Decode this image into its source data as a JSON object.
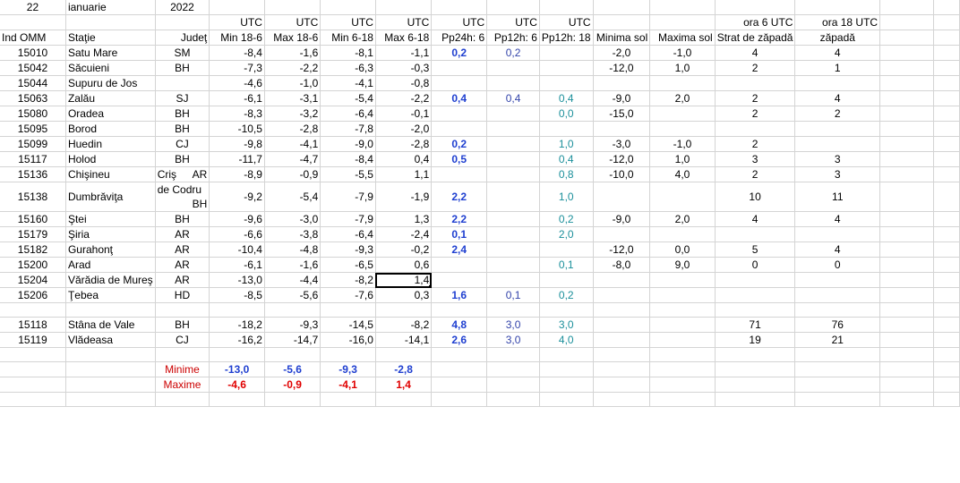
{
  "top": {
    "day": "22",
    "month": "ianuarie",
    "year": "2022"
  },
  "utc_row": [
    "UTC",
    "UTC",
    "UTC",
    "UTC",
    "UTC",
    "UTC",
    "UTC"
  ],
  "utc_row_extra": [
    "ora 6 UTC",
    "ora 18 UTC"
  ],
  "headers": [
    "Ind OMM",
    "Staţie",
    "Judeţ",
    "Min 18-6",
    "Max 18-6",
    "Min 6-18",
    "Max 6-18",
    "Pp24h: 6",
    "Pp12h: 6",
    "Pp12h: 18",
    "Minima sol",
    "Maxima sol",
    "Strat de zăpadă",
    "zăpadă"
  ],
  "rows": [
    {
      "id": "15010",
      "st1": "Satu Mare",
      "st2": "",
      "jud": "SM",
      "min186": "-8,4",
      "max186": "-1,6",
      "min618": "-8,1",
      "max618": "-1,1",
      "pp24": "0,2",
      "pp12a": "0,2",
      "pp12b": "",
      "minsol": "-2,0",
      "maxsol": "-1,0",
      "snow6": "4",
      "snow18": "4"
    },
    {
      "id": "15042",
      "st1": "Săcuieni",
      "st2": "",
      "jud": "BH",
      "min186": "-7,3",
      "max186": "-2,2",
      "min618": "-6,3",
      "max618": "-0,3",
      "pp24": "",
      "pp12a": "",
      "pp12b": "",
      "minsol": "-12,0",
      "maxsol": "1,0",
      "snow6": "2",
      "snow18": "1"
    },
    {
      "id": "15044",
      "st1": "Supuru de Jos",
      "st2": "",
      "jud": "",
      "min186": "-4,6",
      "max186": "-1,0",
      "min618": "-4,1",
      "max618": "-0,8",
      "pp24": "",
      "pp12a": "",
      "pp12b": "",
      "minsol": "",
      "maxsol": "",
      "snow6": "",
      "snow18": ""
    },
    {
      "id": "15063",
      "st1": "Zalău",
      "st2": "",
      "jud": "SJ",
      "min186": "-6,1",
      "max186": "-3,1",
      "min618": "-5,4",
      "max618": "-2,2",
      "pp24": "0,4",
      "pp12a": "0,4",
      "pp12b": "0,4",
      "minsol": "-9,0",
      "maxsol": "2,0",
      "snow6": "2",
      "snow18": "4"
    },
    {
      "id": "15080",
      "st1": "Oradea",
      "st2": "",
      "jud": "BH",
      "min186": "-8,3",
      "max186": "-3,2",
      "min618": "-6,4",
      "max618": "-0,1",
      "pp24": "",
      "pp12a": "",
      "pp12b": "0,0",
      "minsol": "-15,0",
      "maxsol": "",
      "snow6": "2",
      "snow18": "2"
    },
    {
      "id": "15095",
      "st1": "Borod",
      "st2": "",
      "jud": "BH",
      "min186": "-10,5",
      "max186": "-2,8",
      "min618": "-7,8",
      "max618": "-2,0",
      "pp24": "",
      "pp12a": "",
      "pp12b": "",
      "minsol": "",
      "maxsol": "",
      "snow6": "",
      "snow18": ""
    },
    {
      "id": "15099",
      "st1": "Huedin",
      "st2": "",
      "jud": "CJ",
      "min186": "-9,8",
      "max186": "-4,1",
      "min618": "-9,0",
      "max618": "-2,8",
      "pp24": "0,2",
      "pp12a": "",
      "pp12b": "1,0",
      "minsol": "-3,0",
      "maxsol": "-1,0",
      "snow6": "2",
      "snow18": ""
    },
    {
      "id": "15117",
      "st1": "Holod",
      "st2": "",
      "jud": "BH",
      "min186": "-11,7",
      "max186": "-4,7",
      "min618": "-8,4",
      "max618": "0,4",
      "pp24": "0,5",
      "pp12a": "",
      "pp12b": "0,4",
      "minsol": "-12,0",
      "maxsol": "1,0",
      "snow6": "3",
      "snow18": "3"
    },
    {
      "id": "15136",
      "st1": "Chişineu",
      "st2": "Criş",
      "jud": "AR",
      "min186": "-8,9",
      "max186": "-0,9",
      "min618": "-5,5",
      "max618": "1,1",
      "pp24": "",
      "pp12a": "",
      "pp12b": "0,8",
      "minsol": "-10,0",
      "maxsol": "4,0",
      "snow6": "2",
      "snow18": "3"
    },
    {
      "id": "15138",
      "st1": "Dumbrăviţa",
      "st2": "de Codru",
      "jud": "BH",
      "min186": "-9,2",
      "max186": "-5,4",
      "min618": "-7,9",
      "max618": "-1,9",
      "pp24": "2,2",
      "pp12a": "",
      "pp12b": "1,0",
      "minsol": "",
      "maxsol": "",
      "snow6": "10",
      "snow18": "11"
    },
    {
      "id": "15160",
      "st1": "Ştei",
      "st2": "",
      "jud": "BH",
      "min186": "-9,6",
      "max186": "-3,0",
      "min618": "-7,9",
      "max618": "1,3",
      "pp24": "2,2",
      "pp12a": "",
      "pp12b": "0,2",
      "minsol": "-9,0",
      "maxsol": "2,0",
      "snow6": "4",
      "snow18": "4"
    },
    {
      "id": "15179",
      "st1": "Şiria",
      "st2": "",
      "jud": "AR",
      "min186": "-6,6",
      "max186": "-3,8",
      "min618": "-6,4",
      "max618": "-2,4",
      "pp24": "0,1",
      "pp12a": "",
      "pp12b": "2,0",
      "minsol": "",
      "maxsol": "",
      "snow6": "",
      "snow18": ""
    },
    {
      "id": "15182",
      "st1": "Gurahonţ",
      "st2": "",
      "jud": "AR",
      "min186": "-10,4",
      "max186": "-4,8",
      "min618": "-9,3",
      "max618": "-0,2",
      "pp24": "2,4",
      "pp12a": "",
      "pp12b": "",
      "minsol": "-12,0",
      "maxsol": "0,0",
      "snow6": "5",
      "snow18": "4"
    },
    {
      "id": "15200",
      "st1": "Arad",
      "st2": "",
      "jud": "AR",
      "min186": "-6,1",
      "max186": "-1,6",
      "min618": "-6,5",
      "max618": "0,6",
      "pp24": "",
      "pp12a": "",
      "pp12b": "0,1",
      "minsol": "-8,0",
      "maxsol": "9,0",
      "snow6": "0",
      "snow18": "0"
    },
    {
      "id": "15204",
      "st1": "Vărădia de Mureş",
      "st2": "",
      "jud": "AR",
      "min186": "-13,0",
      "max186": "-4,4",
      "min618": "-8,2",
      "max618": "1,4",
      "pp24": "",
      "pp12a": "",
      "pp12b": "",
      "minsol": "",
      "maxsol": "",
      "snow6": "",
      "snow18": ""
    },
    {
      "id": "15206",
      "st1": "Ţebea",
      "st2": "",
      "jud": "HD",
      "min186": "-8,5",
      "max186": "-5,6",
      "min618": "-7,6",
      "max618": "0,3",
      "pp24": "1,6",
      "pp12a": "0,1",
      "pp12b": "0,2",
      "minsol": "",
      "maxsol": "",
      "snow6": "",
      "snow18": ""
    }
  ],
  "mountain_rows": [
    {
      "id": "15118",
      "st1": "Stâna de Vale",
      "st2": "",
      "jud": "BH",
      "min186": "-18,2",
      "max186": "-9,3",
      "min618": "-14,5",
      "max618": "-8,2",
      "pp24": "4,8",
      "pp12a": "3,0",
      "pp12b": "3,0",
      "minsol": "",
      "maxsol": "",
      "snow6": "71",
      "snow18": "76"
    },
    {
      "id": "15119",
      "st1": "Vlădeasa",
      "st2": "",
      "jud": "CJ",
      "min186": "-16,2",
      "max186": "-14,7",
      "min618": "-16,0",
      "max618": "-14,1",
      "pp24": "2,6",
      "pp12a": "3,0",
      "pp12b": "4,0",
      "minsol": "",
      "maxsol": "",
      "snow6": "19",
      "snow18": "21"
    }
  ],
  "summary": {
    "min_label": "Minime",
    "max_label": "Maxime",
    "minime": [
      "-13,0",
      "-5,6",
      "-9,3",
      "-2,8"
    ],
    "maxime": [
      "-4,6",
      "-0,9",
      "-4,1",
      "1,4"
    ]
  },
  "colors": {
    "precip_24h": "#1f3fd0",
    "precip_12h_6": "#3344aa",
    "precip_12h_18": "#1a8f9a",
    "minime": "#1f3fd0",
    "maxime": "#e00000",
    "gridline": "#d4d4d4"
  },
  "selection": {
    "cell": "Max 6-18 / 15204"
  }
}
